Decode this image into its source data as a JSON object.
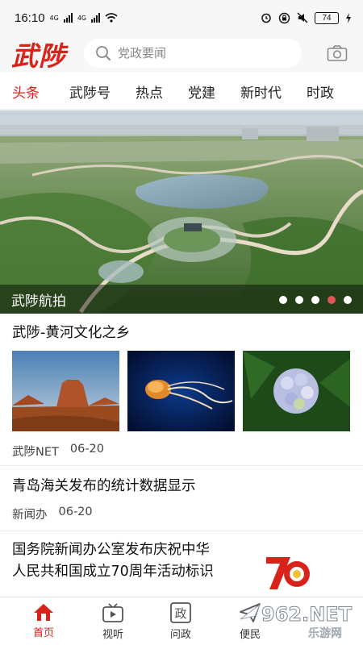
{
  "status_bar": {
    "time": "16:10",
    "network_1": "4G",
    "network_2": "4G",
    "battery": "74"
  },
  "header": {
    "logo_text": "武陟",
    "search_placeholder": "党政要闻"
  },
  "tabs": [
    {
      "label": "头条",
      "active": true
    },
    {
      "label": "武陟号",
      "active": false
    },
    {
      "label": "热点",
      "active": false
    },
    {
      "label": "党建",
      "active": false
    },
    {
      "label": "新时代",
      "active": false
    },
    {
      "label": "时政",
      "active": false
    }
  ],
  "banner": {
    "caption": "武陟航拍",
    "slide_count": 5,
    "active_slide": 4
  },
  "articles": [
    {
      "title": "武陟-黄河文化之乡",
      "source": "武陟NET",
      "date": "06-20"
    },
    {
      "title": "青岛海关发布的统计数据显示",
      "source": "新闻办",
      "date": "06-20"
    },
    {
      "title_line1": "国务院新闻办公室发布庆祝中华",
      "title_line2": "人民共和国成立70周年活动标识"
    }
  ],
  "bottom_nav": [
    {
      "label": "首页",
      "icon": "home-icon",
      "active": true
    },
    {
      "label": "视听",
      "icon": "tv-icon",
      "active": false
    },
    {
      "label": "问政",
      "icon": "zheng-icon",
      "active": false
    },
    {
      "label": "便民",
      "icon": "send-icon",
      "active": false
    }
  ],
  "watermark": {
    "brand": "962.NET",
    "sub": "乐游网"
  },
  "colors": {
    "accent": "#d8231b",
    "dot_active": "#e05555"
  }
}
